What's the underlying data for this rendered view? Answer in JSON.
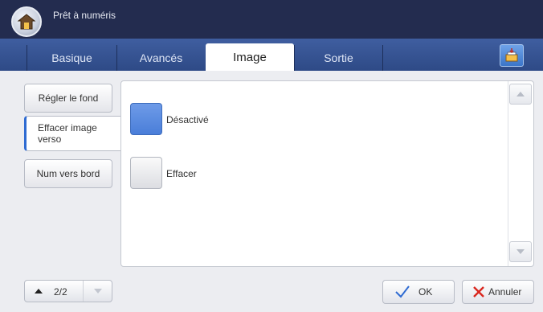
{
  "header": {
    "title": "Prêt à numéris",
    "home_icon": "home-icon"
  },
  "tabs": [
    {
      "label": "Basique",
      "active": false
    },
    {
      "label": "Avancés",
      "active": false
    },
    {
      "label": "Image",
      "active": true
    },
    {
      "label": "Sortie",
      "active": false
    }
  ],
  "tab_action_icon": "job-list-icon",
  "sidebar": {
    "items": [
      {
        "label": "Régler le fond",
        "selected": false
      },
      {
        "label": "Effacer image verso",
        "selected": true
      },
      {
        "label": "Num vers bord",
        "selected": false
      }
    ]
  },
  "panel": {
    "options": [
      {
        "label": "Désactivé",
        "selected": true
      },
      {
        "label": "Effacer",
        "selected": false
      }
    ]
  },
  "pager": {
    "page_text": "2/2"
  },
  "actions": {
    "ok_label": "OK",
    "cancel_label": "Annuler"
  },
  "colors": {
    "header_bg": "#232c4f",
    "tab_bar_bg": "#3552926",
    "selected_option": "#5a8ae0",
    "ok_check": "#2f6bd2",
    "cancel_x": "#d9271f"
  }
}
